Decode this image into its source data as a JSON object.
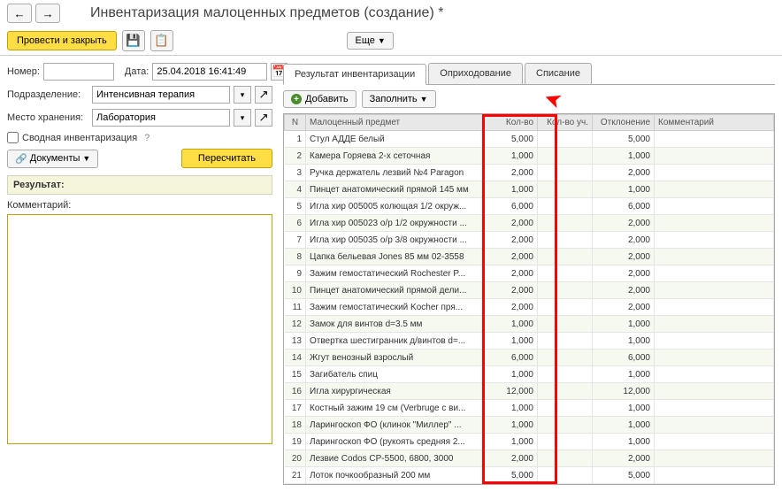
{
  "title": "Инвентаризация малоценных предметов (создание) *",
  "toolbar": {
    "post_close": "Провести и закрыть",
    "more": "Еще"
  },
  "form": {
    "number_label": "Номер:",
    "number_value": "",
    "date_label": "Дата:",
    "date_value": "25.04.2018 16:41:49",
    "dept_label": "Подразделение:",
    "dept_value": "Интенсивная терапия",
    "storage_label": "Место хранения:",
    "storage_value": "Лаборатория",
    "consolidated_label": "Сводная инвентаризация",
    "documents": "Документы",
    "recalc": "Пересчитать",
    "result_header": "Результат:",
    "comment_label": "Комментарий:"
  },
  "tabs": {
    "result": "Результат инвентаризации",
    "receipt": "Оприходование",
    "writeoff": "Списание"
  },
  "tab_toolbar": {
    "add": "Добавить",
    "fill": "Заполнить"
  },
  "columns": {
    "n": "N",
    "item": "Малоценный предмет",
    "qty": "Кол-во",
    "qty_acc": "Кол-во уч.",
    "deviation": "Отклонение",
    "comment": "Комментарий"
  },
  "rows": [
    {
      "n": "1",
      "item": "Стул АДДЕ белый",
      "qty": "5,000",
      "dev": "5,000"
    },
    {
      "n": "2",
      "item": "Камера Горяева 2-х сеточная",
      "qty": "1,000",
      "dev": "1,000"
    },
    {
      "n": "3",
      "item": "Ручка держатель лезвий №4 Paragon",
      "qty": "2,000",
      "dev": "2,000"
    },
    {
      "n": "4",
      "item": "Пинцет анатомический прямой 145 мм",
      "qty": "1,000",
      "dev": "1,000"
    },
    {
      "n": "5",
      "item": "Игла хир 005005 колющая 1/2 окруж...",
      "qty": "6,000",
      "dev": "6,000"
    },
    {
      "n": "6",
      "item": "Игла хир 005023 о/р 1/2 окружности ...",
      "qty": "2,000",
      "dev": "2,000"
    },
    {
      "n": "7",
      "item": "Игла хир 005035 о/р 3/8 окружности ...",
      "qty": "2,000",
      "dev": "2,000"
    },
    {
      "n": "8",
      "item": "Цапка бельевая Jones 85 мм 02-3558",
      "qty": "2,000",
      "dev": "2,000"
    },
    {
      "n": "9",
      "item": "Зажим гемостатический Rochester P...",
      "qty": "2,000",
      "dev": "2,000"
    },
    {
      "n": "10",
      "item": "Пинцет анатомический прямой дели...",
      "qty": "2,000",
      "dev": "2,000"
    },
    {
      "n": "11",
      "item": "Зажим гемостатический Kocher пря...",
      "qty": "2,000",
      "dev": "2,000"
    },
    {
      "n": "12",
      "item": "Замок для винтов d=3.5 мм",
      "qty": "1,000",
      "dev": "1,000"
    },
    {
      "n": "13",
      "item": "Отвертка шестигранник д/винтов d=...",
      "qty": "1,000",
      "dev": "1,000"
    },
    {
      "n": "14",
      "item": "Жгут венозный взрослый",
      "qty": "6,000",
      "dev": "6,000"
    },
    {
      "n": "15",
      "item": "Загибатель спиц",
      "qty": "1,000",
      "dev": "1,000"
    },
    {
      "n": "16",
      "item": "Игла хирургическая",
      "qty": "12,000",
      "dev": "12,000"
    },
    {
      "n": "17",
      "item": "Костный зажим 19 см (Verbruge  с ви...",
      "qty": "1,000",
      "dev": "1,000"
    },
    {
      "n": "18",
      "item": "Ларингоскоп ФО (клинок \"Миллер\" ...",
      "qty": "1,000",
      "dev": "1,000"
    },
    {
      "n": "19",
      "item": "Ларингоскоп ФО (рукоять средняя 2...",
      "qty": "1,000",
      "dev": "1,000"
    },
    {
      "n": "20",
      "item": "Лезвие Codos CP-5500, 6800, 3000",
      "qty": "2,000",
      "dev": "2,000"
    },
    {
      "n": "21",
      "item": "Лоток почкообразный 200 мм",
      "qty": "5,000",
      "dev": "5,000"
    }
  ]
}
